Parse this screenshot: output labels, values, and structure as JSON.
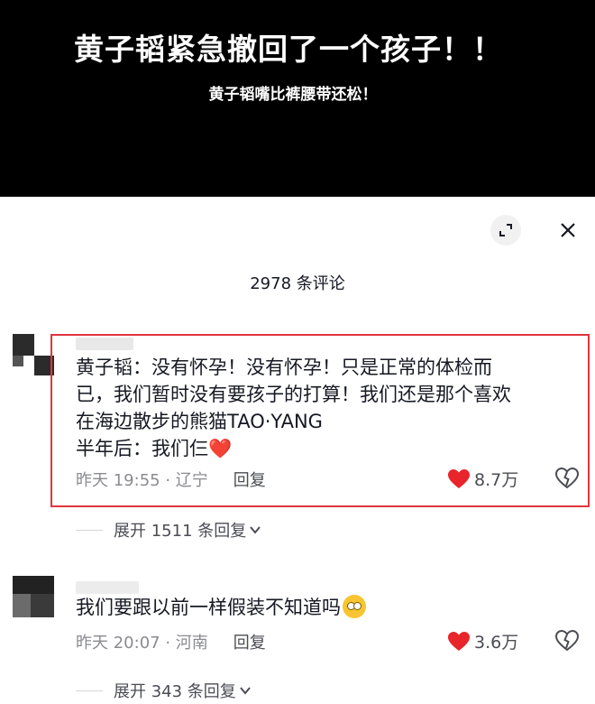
{
  "banner": {
    "title": "黄子韬紧急撤回了一个孩子！！",
    "subtitle": "黄子韬嘴比裤腰带还松！"
  },
  "panel": {
    "count_label": "2978 条评论",
    "expand_icon": "expand-icon",
    "close_icon": "close-icon"
  },
  "comments": [
    {
      "lines": [
        "黄子韬：没有怀孕！没有怀孕！只是正常的体检而",
        "已，我们暂时没有要孩子的打算！我们还是那个喜欢",
        "在海边散步的熊猫TAO·YANG",
        "半年后：我们仨"
      ],
      "emoji": "❤️",
      "time": "昨天 19:55 · 辽宁",
      "reply_label": "回复",
      "likes": "8.7万",
      "expand_label": "展开 1511 条回复"
    },
    {
      "text": "我们要跟以前一样假装不知道吗",
      "emoji": "flushed-face",
      "time": "昨天 20:07 · 河南",
      "reply_label": "回复",
      "likes": "3.6万",
      "expand_label": "展开 343 条回复"
    }
  ],
  "colors": {
    "heart": "#e8252b",
    "highlight_border": "#e0353f",
    "banner_bg": "#000000"
  }
}
